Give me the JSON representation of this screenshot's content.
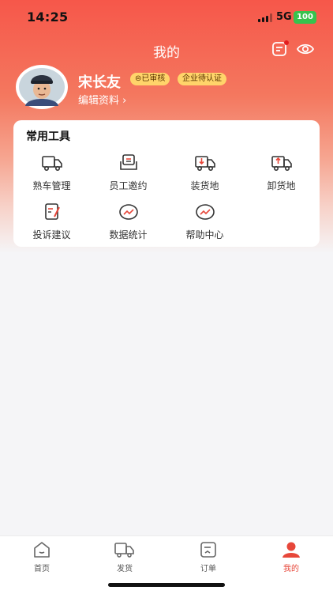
{
  "status_bar": {
    "time": "14:25",
    "network": "5G",
    "battery": "100"
  },
  "header": {
    "title": "我的",
    "icons": [
      "message-list-icon",
      "eye-icon"
    ]
  },
  "profile": {
    "name": "宋长友",
    "badges": [
      "已审核",
      "企业待认证"
    ],
    "edit_label": "编辑资料"
  },
  "tools": {
    "title": "常用工具",
    "items": [
      {
        "label": "熟车管理",
        "icon": "truck-icon"
      },
      {
        "label": "员工邀约",
        "icon": "invite-icon"
      },
      {
        "label": "装货地",
        "icon": "loading-truck-icon"
      },
      {
        "label": "卸货地",
        "icon": "unloading-truck-icon"
      },
      {
        "label": "投诉建议",
        "icon": "complaint-icon"
      },
      {
        "label": "数据统计",
        "icon": "chart-icon"
      },
      {
        "label": "帮助中心",
        "icon": "help-icon"
      }
    ]
  },
  "tabbar": {
    "items": [
      {
        "label": "首页",
        "icon": "home-icon"
      },
      {
        "label": "发货",
        "icon": "ship-icon"
      },
      {
        "label": "订单",
        "icon": "order-icon"
      },
      {
        "label": "我的",
        "icon": "profile-icon",
        "active": true
      }
    ]
  },
  "colors": {
    "accent": "#e7473a",
    "badge": "#ffd46a",
    "gradient_top": "#f6574a"
  }
}
